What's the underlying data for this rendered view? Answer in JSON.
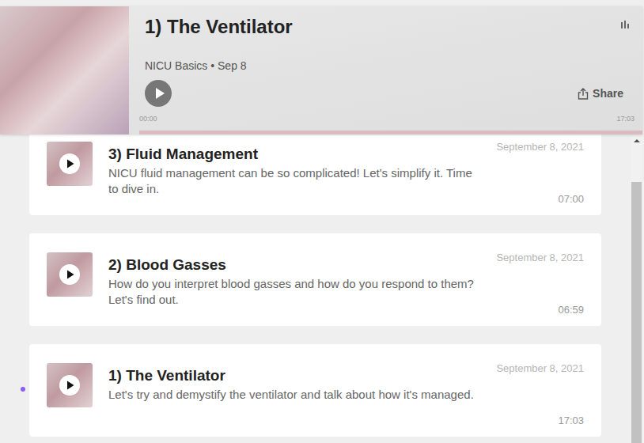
{
  "player": {
    "title": "1) The Ventilator",
    "meta": "NICU Basics • Sep 8",
    "elapsed": "00:00",
    "duration": "17:03",
    "share": "Share",
    "progress": 1
  },
  "episodes": [
    {
      "title": "3) Fluid Management",
      "description": "NICU fluid management can be so complicated! Let's simplify it. Time to dive in.",
      "date": "September 8, 2021",
      "duration": "07:00",
      "selected": false
    },
    {
      "title": "2) Blood Gasses",
      "description": "How do you interpret blood gasses and how do you respond to them? Let's find out.",
      "date": "September 8, 2021",
      "duration": "06:59",
      "selected": false
    },
    {
      "title": "1) The Ventilator",
      "description": "Let's try and demystify the ventilator and talk about how it's managed.",
      "date": "September 8, 2021",
      "duration": "17:03",
      "selected": true
    }
  ]
}
